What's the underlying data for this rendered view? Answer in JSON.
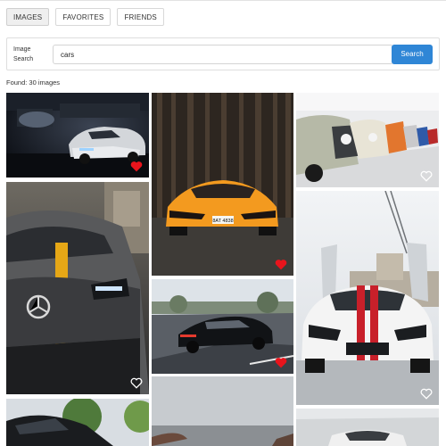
{
  "tabs": [
    {
      "label": "IMAGES",
      "active": true
    },
    {
      "label": "FAVORITES",
      "active": false
    },
    {
      "label": "FRIENDS",
      "active": false
    }
  ],
  "search": {
    "label_line1": "Image",
    "label_line2": "Search",
    "value": "cars",
    "button_label": "Search"
  },
  "found_text": "Found: 30 images",
  "photos": [
    {
      "name": "photo-white-camaro",
      "favorite": true
    },
    {
      "name": "photo-orange-lamborghini",
      "favorite": true,
      "plate": "8AT 4838"
    },
    {
      "name": "photo-classic-bmw-row",
      "favorite": false
    },
    {
      "name": "photo-grey-mercedes-amg",
      "favorite": false
    },
    {
      "name": "photo-black-porsche-road",
      "favorite": true
    },
    {
      "name": "photo-white-mustang",
      "favorite": false
    },
    {
      "name": "photo-black-car-trees",
      "favorite": false
    },
    {
      "name": "photo-road-overcast",
      "favorite": false
    },
    {
      "name": "photo-white-car-front",
      "favorite": false
    }
  ],
  "colors": {
    "accent": "#2f86d6",
    "heart_filled": "#e8141c",
    "heart_outline": "#ffffff"
  }
}
